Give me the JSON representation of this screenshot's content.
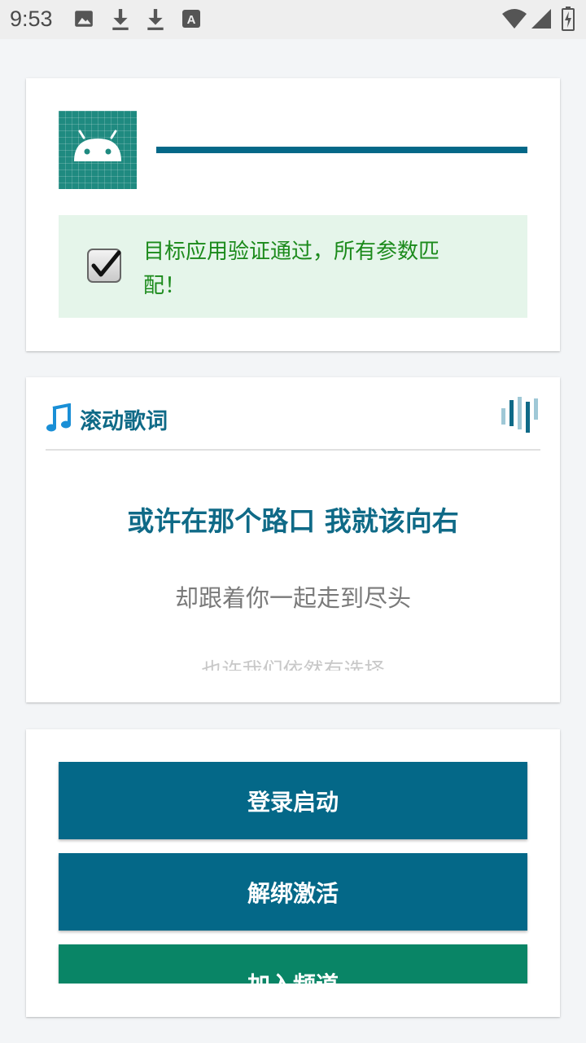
{
  "status_bar": {
    "time": "9:53",
    "left_icons": [
      "image-icon",
      "download-icon",
      "download-icon",
      "font-icon"
    ],
    "right_icons": [
      "wifi-icon",
      "signal-icon",
      "battery-charging-icon"
    ]
  },
  "verification": {
    "message": "目标应用验证通过，所有参数匹配！",
    "success_color": "#1b8a1b",
    "background_color": "#e5f5ea"
  },
  "lyrics": {
    "title": "滚动歌词",
    "current_line": "或许在那个路口 我就该向右",
    "next_line": "却跟着你一起走到尽头",
    "faded_line": "也许我们依然有选择"
  },
  "actions": {
    "login_label": "登录启动",
    "unbind_label": "解绑激活",
    "join_label": "加入频道"
  },
  "colors": {
    "primary": "#046888",
    "secondary": "#098566",
    "background": "#f3f5f7"
  }
}
